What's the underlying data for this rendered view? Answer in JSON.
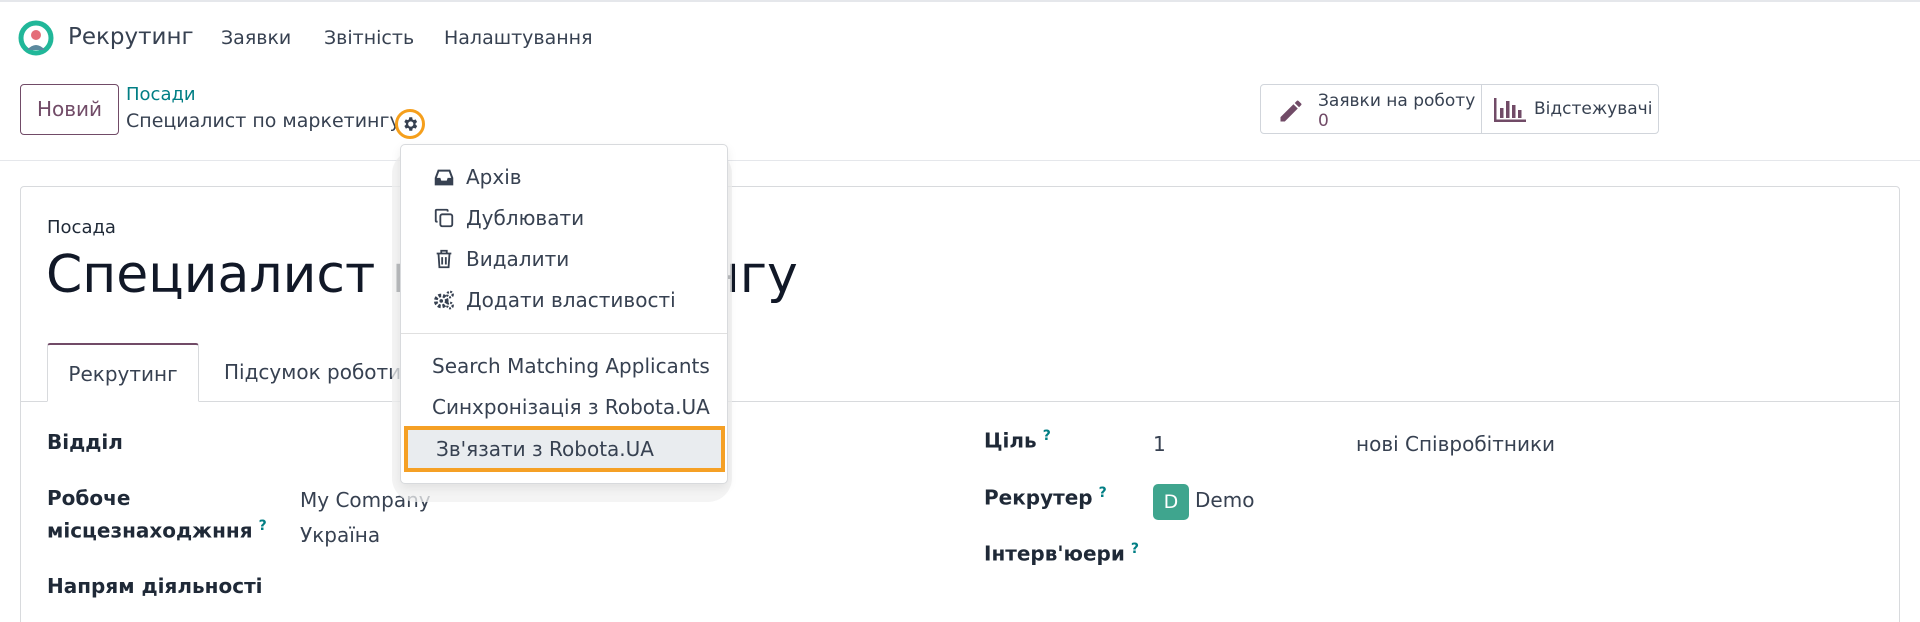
{
  "navbar": {
    "app_name": "Рекрутинг",
    "items": [
      "Заявки",
      "Звітність",
      "Налаштування"
    ]
  },
  "control_panel": {
    "new_button": "Новий",
    "breadcrumb_parent": "Посади",
    "breadcrumb_current": "Специалист по маркетингу",
    "stat_applications": {
      "label": "Заявки на роботу",
      "value": "0"
    },
    "stat_trackers": {
      "label": "Відстежувачі"
    }
  },
  "gear_menu": {
    "items": [
      {
        "label": "Архів",
        "icon": "archive-icon"
      },
      {
        "label": "Дублювати",
        "icon": "copy-icon"
      },
      {
        "label": "Видалити",
        "icon": "trash-icon"
      },
      {
        "label": "Додати властивості",
        "icon": "cogs-icon"
      }
    ],
    "actions": [
      "Search Matching Applicants",
      "Синхронізація з Robota.UA",
      "Зв'язати з Robota.UA"
    ]
  },
  "form": {
    "caption": "Посада",
    "title": "Специалист по маркетингу",
    "tabs": [
      "Рекрутинг",
      "Підсумок роботи"
    ],
    "fields": {
      "department": {
        "label": "Відділ",
        "value": ""
      },
      "work_location": {
        "label_line1": "Робоче",
        "label_line2": "місцезнаходжння",
        "value_line1": "My Company",
        "value_line2": "Україна"
      },
      "activity": {
        "label": "Напрям діяльності",
        "value": ""
      },
      "target": {
        "label": "Ціль",
        "value": "1",
        "suffix": "нові Співробітники"
      },
      "recruiter": {
        "label": "Рекрутер",
        "avatar": "D",
        "value": "Demo"
      },
      "interviewers": {
        "label": "Інтерв'юери",
        "value": ""
      }
    }
  },
  "colors": {
    "brand": "#714B67",
    "link": "#017e84",
    "highlight": "#f5a025",
    "avatar": "#3fa58e"
  }
}
